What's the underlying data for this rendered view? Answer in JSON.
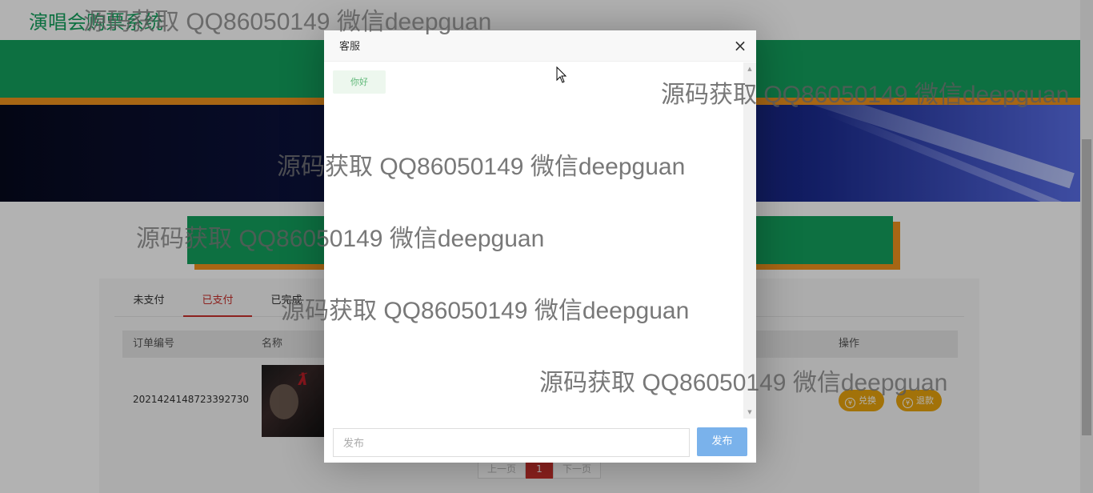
{
  "site": {
    "title": "演唱会购票系统"
  },
  "tabs": [
    {
      "label": "未支付"
    },
    {
      "label": "已支付"
    },
    {
      "label": "已完成"
    }
  ],
  "active_tab": "已支付",
  "table": {
    "headers": [
      "订单编号",
      "名称",
      "操作"
    ],
    "rows": [
      {
        "order_no": "2021424148723392730",
        "actions": [
          "兑换",
          "退款"
        ]
      }
    ]
  },
  "pagination": {
    "prev": "上一页",
    "current": "1",
    "next": "下一页"
  },
  "modal": {
    "title": "客服",
    "close": "×",
    "messages": [
      {
        "text": "你好"
      }
    ],
    "input_placeholder": "发布",
    "submit_label": "发布"
  },
  "watermark": "源码获取 QQ86050149 微信deepguan",
  "colors": {
    "brand_green": "#13a15e",
    "accent_orange": "#f0931e",
    "active_red": "#c9302c",
    "gold": "#e8a40e",
    "button_blue": "#7ab2eb"
  }
}
